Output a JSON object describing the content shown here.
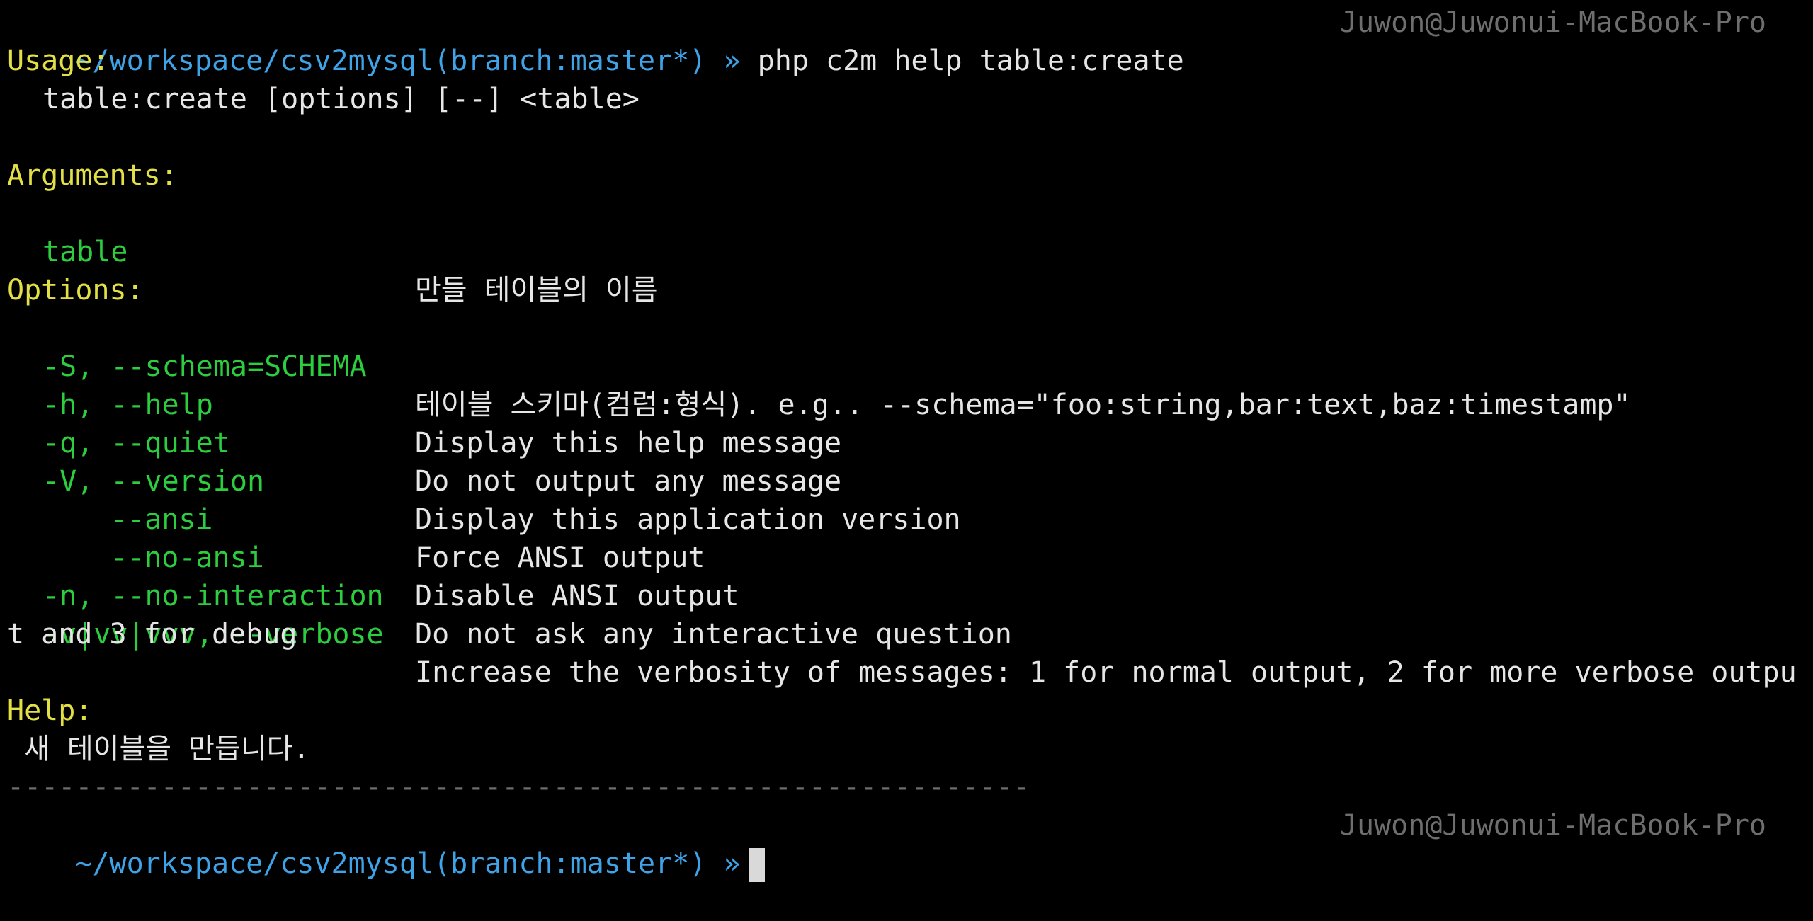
{
  "prompt1": {
    "path": "~/workspace/csv2mysql",
    "branch": "(branch:master*)",
    "arrow": "»",
    "command": "php c2m help table:create",
    "user_host": "Juwon@Juwonui-MacBook-Pro"
  },
  "usage": {
    "heading": "Usage:",
    "line": "table:create [options] [--] <table>"
  },
  "arguments": {
    "heading": "Arguments:",
    "items": [
      {
        "name": "table",
        "desc": "만들 테이블의 이름"
      }
    ]
  },
  "options": {
    "heading": "Options:",
    "items": [
      {
        "name": "-S, --schema=SCHEMA",
        "desc": "테이블 스키마(컴럼:형식). e.g.. --schema=\"foo:string,bar:text,baz:timestamp\""
      },
      {
        "name": "-h, --help",
        "desc": "Display this help message"
      },
      {
        "name": "-q, --quiet",
        "desc": "Do not output any message"
      },
      {
        "name": "-V, --version",
        "desc": "Display this application version"
      },
      {
        "name": "--ansi",
        "desc": "Force ANSI output"
      },
      {
        "name": "--no-ansi",
        "desc": "Disable ANSI output"
      },
      {
        "name": "-n, --no-interaction",
        "desc": "Do not ask any interactive question"
      },
      {
        "name": "-v|vv|vvv, --verbose",
        "desc": "Increase the verbosity of messages: 1 for normal output, 2 for more verbose outpu"
      }
    ],
    "wrap_line": "t and 3 for debug"
  },
  "help": {
    "heading": "Help:",
    "text": "새 테이블을 만듭니다."
  },
  "separator": "------------------------------------------------------------",
  "prompt2": {
    "path": "~/workspace/csv2mysql",
    "branch": "(branch:master*)",
    "arrow": "»",
    "user_host": "Juwon@Juwonui-MacBook-Pro"
  },
  "colors": {
    "background": "#000000",
    "path": "#3fa3e8",
    "heading": "#e3e046",
    "option": "#2ccd3e",
    "text": "#e6e6e6",
    "dim": "#6e6e6e"
  }
}
